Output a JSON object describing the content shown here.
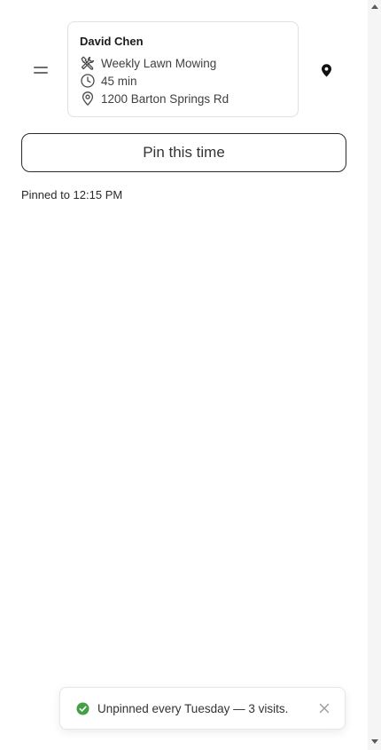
{
  "visit": {
    "customer_name": "David Chen",
    "service": "Weekly Lawn Mowing",
    "duration": "45 min",
    "address": "1200 Barton Springs Rd"
  },
  "actions": {
    "pin_label": "Pin this time"
  },
  "status": {
    "pinned_text": "Pinned to 12:15 PM"
  },
  "toast": {
    "message": "Unpinned every Tuesday — 3 visits.",
    "success_color": "#43a047"
  },
  "icons": {
    "handle": "drag-handle-icon",
    "service": "tools-icon",
    "duration": "clock-icon",
    "address": "location-pin-icon",
    "map": "map-pin-icon",
    "toast_status": "check-circle-icon",
    "toast_close": "close-icon"
  }
}
